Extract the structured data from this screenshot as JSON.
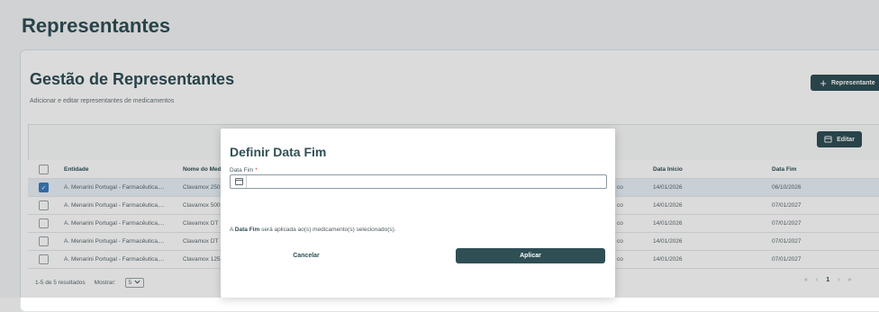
{
  "page": {
    "title": "Representantes"
  },
  "card": {
    "title": "Gestão de Representantes",
    "subtitle": "Adicionar e editar representantes de medicamentos",
    "add_button_label": "Representante",
    "edit_button_label": "Editar"
  },
  "table": {
    "headers": {
      "entidade": "Entidade",
      "nome": "Nome do Med",
      "data_inicio": "Data Início",
      "data_fim": "Data Fim"
    },
    "rows": [
      {
        "selected": true,
        "entidade": "A. Menarini Portugal - Farmacêutica,...",
        "nome": "Clavamox 250",
        "co": "co",
        "data_inicio": "14/01/2026",
        "data_fim": "06/10/2026"
      },
      {
        "selected": false,
        "entidade": "A. Menarini Portugal - Farmacêutica,...",
        "nome": "Clavamox 500",
        "co": "co",
        "data_inicio": "14/01/2026",
        "data_fim": "07/01/2027"
      },
      {
        "selected": false,
        "entidade": "A. Menarini Portugal - Farmacêutica,...",
        "nome": "Clavamox DT",
        "co": "co",
        "data_inicio": "14/01/2026",
        "data_fim": "07/01/2027"
      },
      {
        "selected": false,
        "entidade": "A. Menarini Portugal - Farmacêutica,...",
        "nome": "Clavamox DT",
        "co": "co",
        "data_inicio": "14/01/2026",
        "data_fim": "07/01/2027"
      },
      {
        "selected": false,
        "entidade": "A. Menarini Portugal - Farmacêutica,...",
        "nome": "Clavamox 125",
        "co": "co",
        "data_inicio": "14/01/2026",
        "data_fim": "07/01/2027"
      }
    ]
  },
  "footer": {
    "results_text": "1-5 de 5 resultados",
    "show_label": "Mostrar:",
    "page_size": "5",
    "current_page": "1",
    "first": "«",
    "prev": "‹",
    "next": "›",
    "last": "»"
  },
  "modal": {
    "title": "Definir Data Fim",
    "field_label": "Data Fim",
    "required_mark": "*",
    "date_value": "",
    "info_prefix": "A",
    "info_bold": "Data Fim",
    "info_suffix": "será aplicada ao(s) medicamento(s) selecionado(s).",
    "cancel_label": "Cancelar",
    "apply_label": "Aplicar"
  },
  "icons": {
    "add": "plus-icon",
    "edit": "calendar-icon",
    "date": "calendar-icon",
    "select": "chevron-down-icon"
  },
  "colors": {
    "primary": "#2f4f55",
    "selected_row": "#e9f2f8",
    "checkbox_on": "#3c7cc1",
    "required": "#d9342b"
  }
}
